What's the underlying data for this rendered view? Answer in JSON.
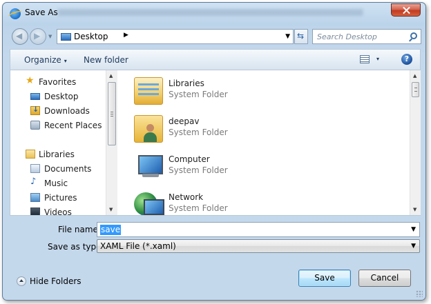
{
  "window": {
    "title": "Save As",
    "blurred_path": "D:\\Users\\Silverlight\\Samples\\Diagram.Silverlight.Samples.Xaml\\Bin\\Debug\\TestPage.html"
  },
  "address": {
    "location": "Desktop",
    "separator": "▶",
    "dropdown": "▼",
    "refresh_glyph": "⇆"
  },
  "search": {
    "placeholder": "Search Desktop"
  },
  "toolbar": {
    "organize_label": "Organize",
    "organize_caret": "▾",
    "new_folder_label": "New folder",
    "views_caret": "▾",
    "help_glyph": "?"
  },
  "sidebar": {
    "items": [
      {
        "label": "Favorites",
        "icon": "star-icon",
        "glyph": "★"
      },
      {
        "label": "Desktop",
        "icon": "desktop-icon",
        "glyph": ""
      },
      {
        "label": "Downloads",
        "icon": "downloads-icon",
        "glyph": ""
      },
      {
        "label": "Recent Places",
        "icon": "recent-places-icon",
        "glyph": ""
      },
      {
        "label": "Libraries",
        "icon": "libraries-icon",
        "glyph": ""
      },
      {
        "label": "Documents",
        "icon": "documents-icon",
        "glyph": ""
      },
      {
        "label": "Music",
        "icon": "music-icon",
        "glyph": "♪"
      },
      {
        "label": "Pictures",
        "icon": "pictures-icon",
        "glyph": ""
      },
      {
        "label": "Videos",
        "icon": "videos-icon",
        "glyph": ""
      }
    ]
  },
  "files": [
    {
      "name": "Libraries",
      "type": "System Folder",
      "icon": "libraries-folder-icon"
    },
    {
      "name": "deepav",
      "type": "System Folder",
      "icon": "user-folder-icon"
    },
    {
      "name": "Computer",
      "type": "System Folder",
      "icon": "computer-icon"
    },
    {
      "name": "Network",
      "type": "System Folder",
      "icon": "network-icon"
    }
  ],
  "form": {
    "filename_label": "File name:",
    "filename_value": "save",
    "savetype_label": "Save as type:",
    "savetype_value": "XAML File (*.xaml)",
    "dropdown": "▼"
  },
  "scroll": {
    "up": "▲",
    "down": "▼"
  },
  "footer": {
    "hide_folders_label": "Hide Folders",
    "save_label": "Save",
    "cancel_label": "Cancel"
  },
  "colors": {
    "accent": "#3399ff",
    "frame": "#c4d8ec",
    "close_button": "#c23b21"
  }
}
